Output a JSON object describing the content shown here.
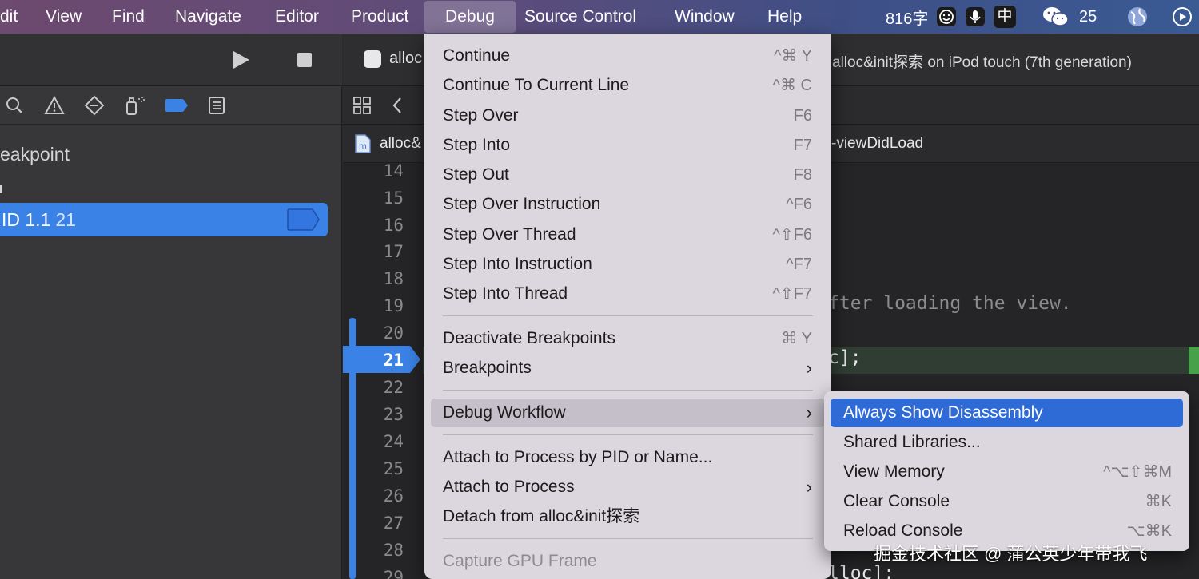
{
  "menubar": {
    "items": [
      "dit",
      "View",
      "Find",
      "Navigate",
      "Editor",
      "Product",
      "Debug",
      "Source Control",
      "Window",
      "Help"
    ],
    "active": "Debug",
    "status": {
      "word_count": "816字",
      "ime": "中",
      "wechat_count": "25"
    }
  },
  "navigator": {
    "title": "eakpoint",
    "breakpoint_label": "ID 1.1",
    "breakpoint_line": "21"
  },
  "editor": {
    "tab_title": "alloc",
    "scheme_title": "alloc&init探索 on iPod touch (7th generation)",
    "crumb_file": "alloc&",
    "crumb_method": "-viewDidLoad",
    "line_numbers": [
      "14",
      "15",
      "16",
      "17",
      "18",
      "19",
      "20",
      "21",
      "22",
      "23",
      "24",
      "25",
      "26",
      "27",
      "28",
      "29"
    ],
    "current_line": "21",
    "code_fragments": {
      "comment": "fter loading the view.",
      "line21": "c];",
      "line29": "lloc];"
    }
  },
  "debug_menu": {
    "items": [
      {
        "label": "Continue",
        "shortcut": "^⌘ Y"
      },
      {
        "label": "Continue To Current Line",
        "shortcut": "^⌘ C"
      },
      {
        "label": "Step Over",
        "shortcut": "F6"
      },
      {
        "label": "Step Into",
        "shortcut": "F7"
      },
      {
        "label": "Step Out",
        "shortcut": "F8"
      },
      {
        "label": "Step Over Instruction",
        "shortcut": "^F6"
      },
      {
        "label": "Step Over Thread",
        "shortcut": "^⇧F6"
      },
      {
        "label": "Step Into Instruction",
        "shortcut": "^F7"
      },
      {
        "label": "Step Into Thread",
        "shortcut": "^⇧F7"
      },
      {
        "label": "Deactivate Breakpoints",
        "shortcut": "⌘ Y"
      },
      {
        "label": "Breakpoints",
        "shortcut": ""
      },
      {
        "label": "Debug Workflow",
        "shortcut": ""
      },
      {
        "label": "Attach to Process by PID or Name...",
        "shortcut": ""
      },
      {
        "label": "Attach to Process",
        "shortcut": ""
      },
      {
        "label": "Detach from alloc&init探索",
        "shortcut": ""
      },
      {
        "label": "Capture GPU Frame",
        "shortcut": ""
      }
    ]
  },
  "submenu": {
    "items": [
      {
        "label": "Always Show Disassembly",
        "shortcut": ""
      },
      {
        "label": "Shared Libraries...",
        "shortcut": ""
      },
      {
        "label": "View Memory",
        "shortcut": "^⌥⇧⌘M"
      },
      {
        "label": "Clear Console",
        "shortcut": "⌘K"
      },
      {
        "label": "Reload Console",
        "shortcut": "⌥⌘K"
      }
    ]
  },
  "watermark": "掘金技术社区 @ 蒲公英少年带我飞",
  "colors": {
    "selection": "#2f6bd6",
    "breakpoint": "#3b82e6",
    "menu_bg": "#dcd6de"
  }
}
